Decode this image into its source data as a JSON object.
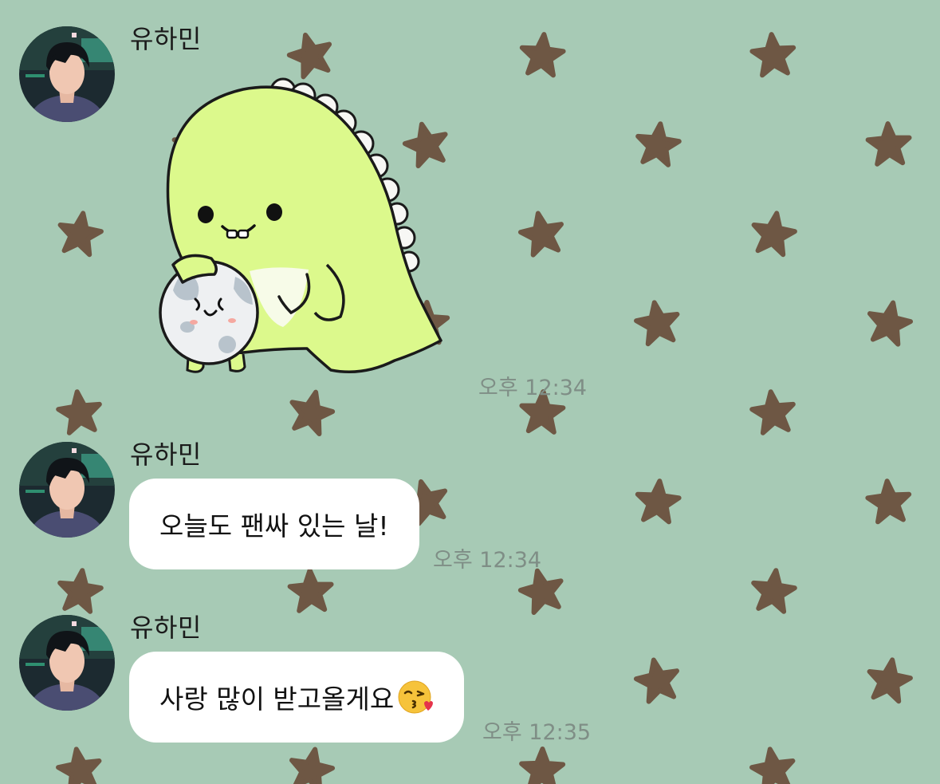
{
  "colors": {
    "background": "#a7cab5",
    "star": "#6e5744",
    "bubble": "#ffffff",
    "timestamp": "#7f8e86",
    "dino_body": "#dcf98c"
  },
  "messages": [
    {
      "sender": "유하민",
      "type": "sticker",
      "sticker_icon": "dinosaur-holding-egg-sticker",
      "time": "오후 12:34"
    },
    {
      "sender": "유하민",
      "type": "text",
      "text": "오늘도 팬싸 있는 날!",
      "time": "오후 12:34"
    },
    {
      "sender": "유하민",
      "type": "text",
      "text": "사랑 많이 받고올게요",
      "emoji": "face-blowing-kiss-emoji",
      "time": "오후 12:35"
    }
  ]
}
